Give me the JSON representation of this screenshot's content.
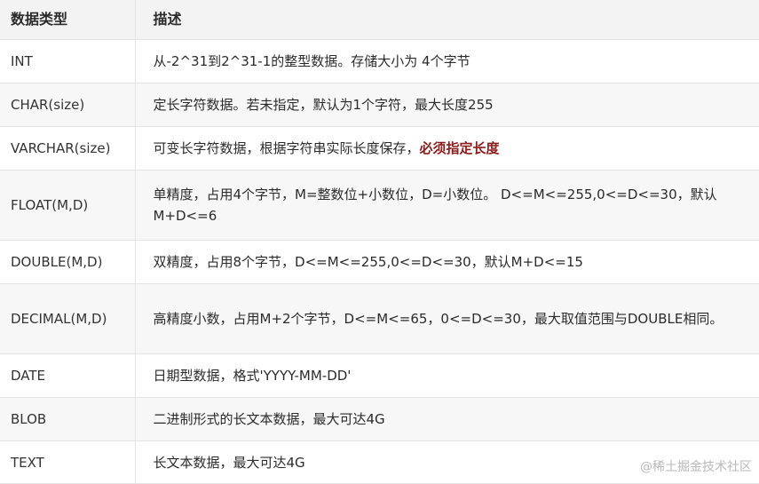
{
  "header": {
    "col_type": "数据类型",
    "col_desc": "描述"
  },
  "rows": [
    {
      "type": "INT",
      "desc": "从-2^31到2^31-1的整型数据。存储大小为 4个字节",
      "emph": ""
    },
    {
      "type": "CHAR(size)",
      "desc": "定长字符数据。若未指定，默认为1个字符，最大长度255",
      "emph": ""
    },
    {
      "type": "VARCHAR(size)",
      "desc": "可变长字符数据，根据字符串实际长度保存，",
      "emph": "必须指定长度"
    },
    {
      "type": "FLOAT(M,D)",
      "desc": "单精度，占用4个字节，M=整数位+小数位，D=小数位。 D<=M<=255,0<=D<=30，默认M+D<=6",
      "emph": ""
    },
    {
      "type": "DOUBLE(M,D)",
      "desc": "双精度，占用8个字节，D<=M<=255,0<=D<=30，默认M+D<=15",
      "emph": ""
    },
    {
      "type": "DECIMAL(M,D)",
      "desc": "高精度小数，占用M+2个字节，D<=M<=65，0<=D<=30，最大取值范围与DOUBLE相同。",
      "emph": ""
    },
    {
      "type": "DATE",
      "desc": "日期型数据，格式'YYYY-MM-DD'",
      "emph": ""
    },
    {
      "type": "BLOB",
      "desc": "二进制形式的长文本数据，最大可达4G",
      "emph": ""
    },
    {
      "type": "TEXT",
      "desc": "长文本数据，最大可达4G",
      "emph": ""
    }
  ],
  "watermark": "@稀土掘金技术社区"
}
